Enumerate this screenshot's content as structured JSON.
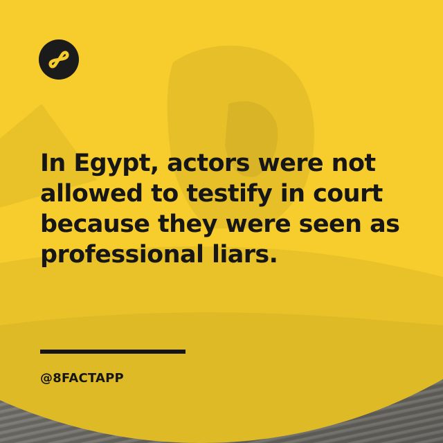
{
  "brand": {
    "logo_icon": "infinity-eight-icon",
    "logo_bg": "#1b1b1b",
    "logo_fg": "#f6cd2c",
    "accent_yellow": "#f6cd2c",
    "text_color": "#161616"
  },
  "fact": {
    "text": "In Egypt, actors were not allowed to testify in court because they were seen as professional liars."
  },
  "footer": {
    "handle": "@8FACTAPP"
  }
}
